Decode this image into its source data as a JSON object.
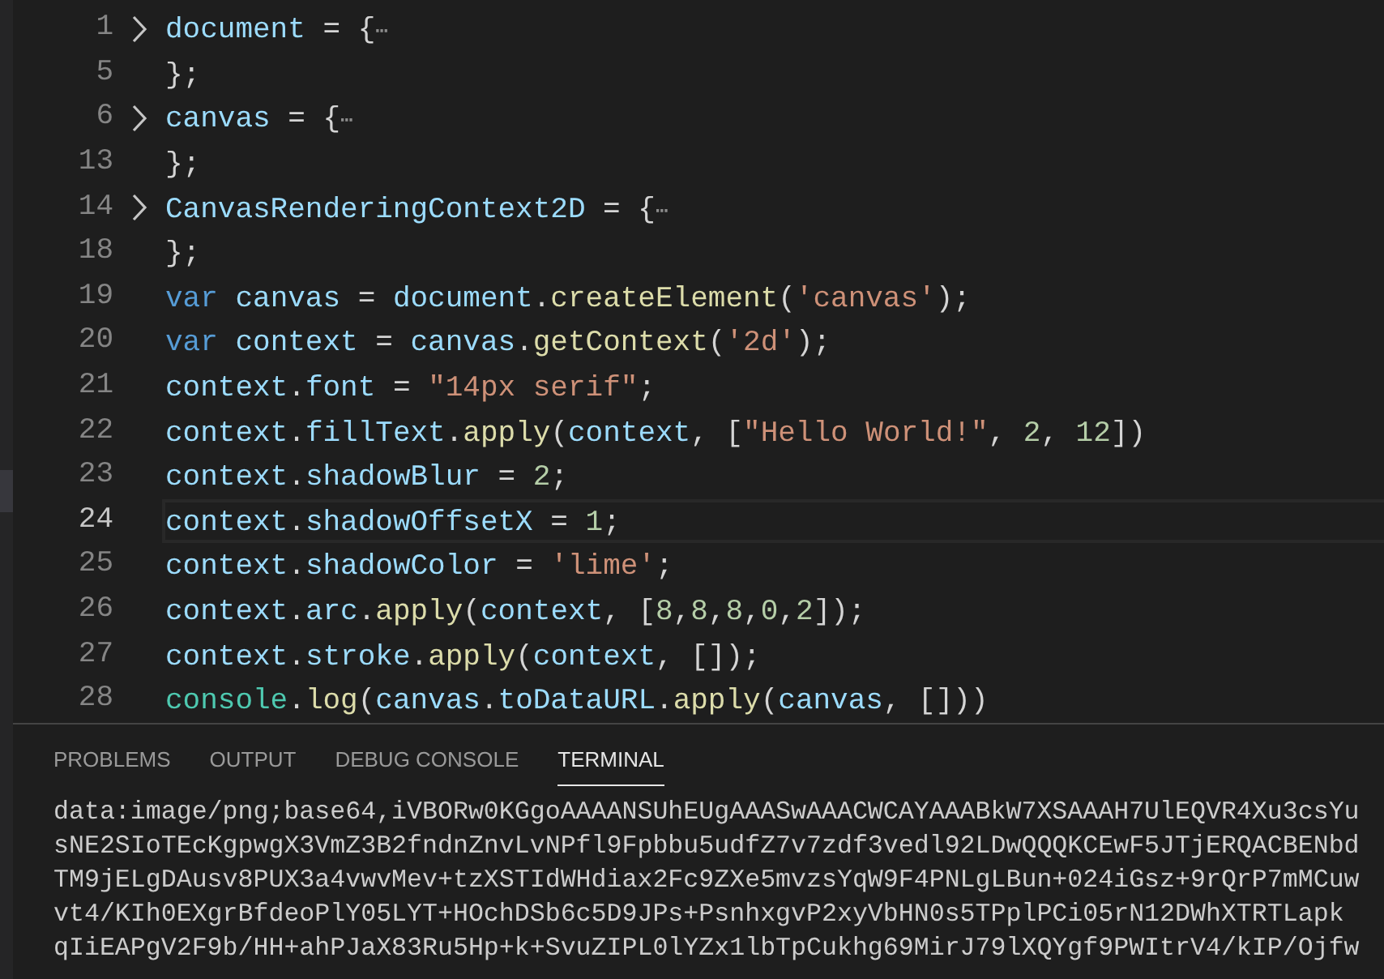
{
  "editor": {
    "lines": [
      {
        "number": "1",
        "foldable": true,
        "current": false,
        "tokens": [
          {
            "kind": "variable",
            "text": "document"
          },
          {
            "kind": "punct",
            "text": " = {"
          },
          {
            "kind": "ellipsis",
            "text": "⋯"
          }
        ]
      },
      {
        "number": "5",
        "foldable": false,
        "current": false,
        "tokens": [
          {
            "kind": "punct",
            "text": "};"
          }
        ]
      },
      {
        "number": "6",
        "foldable": true,
        "current": false,
        "tokens": [
          {
            "kind": "variable",
            "text": "canvas"
          },
          {
            "kind": "punct",
            "text": " = {"
          },
          {
            "kind": "ellipsis",
            "text": "⋯"
          }
        ]
      },
      {
        "number": "13",
        "foldable": false,
        "current": false,
        "tokens": [
          {
            "kind": "punct",
            "text": "};"
          }
        ]
      },
      {
        "number": "14",
        "foldable": true,
        "current": false,
        "tokens": [
          {
            "kind": "variable",
            "text": "CanvasRenderingContext2D"
          },
          {
            "kind": "punct",
            "text": " = {"
          },
          {
            "kind": "ellipsis",
            "text": "⋯"
          }
        ]
      },
      {
        "number": "18",
        "foldable": false,
        "current": false,
        "tokens": [
          {
            "kind": "punct",
            "text": "};"
          }
        ]
      },
      {
        "number": "19",
        "foldable": false,
        "current": false,
        "tokens": [
          {
            "kind": "keyword",
            "text": "var "
          },
          {
            "kind": "variable",
            "text": "canvas"
          },
          {
            "kind": "punct",
            "text": " = "
          },
          {
            "kind": "variable",
            "text": "document"
          },
          {
            "kind": "punct",
            "text": "."
          },
          {
            "kind": "function",
            "text": "createElement"
          },
          {
            "kind": "punct",
            "text": "("
          },
          {
            "kind": "string",
            "text": "'canvas'"
          },
          {
            "kind": "punct",
            "text": ");"
          }
        ]
      },
      {
        "number": "20",
        "foldable": false,
        "current": false,
        "tokens": [
          {
            "kind": "keyword",
            "text": "var "
          },
          {
            "kind": "variable",
            "text": "context"
          },
          {
            "kind": "punct",
            "text": " = "
          },
          {
            "kind": "variable",
            "text": "canvas"
          },
          {
            "kind": "punct",
            "text": "."
          },
          {
            "kind": "function",
            "text": "getContext"
          },
          {
            "kind": "punct",
            "text": "("
          },
          {
            "kind": "string",
            "text": "'2d'"
          },
          {
            "kind": "punct",
            "text": ");"
          }
        ]
      },
      {
        "number": "21",
        "foldable": false,
        "current": false,
        "tokens": [
          {
            "kind": "variable",
            "text": "context"
          },
          {
            "kind": "punct",
            "text": "."
          },
          {
            "kind": "variable",
            "text": "font"
          },
          {
            "kind": "punct",
            "text": " = "
          },
          {
            "kind": "string",
            "text": "\"14px serif\""
          },
          {
            "kind": "punct",
            "text": ";"
          }
        ]
      },
      {
        "number": "22",
        "foldable": false,
        "current": false,
        "tokens": [
          {
            "kind": "variable",
            "text": "context"
          },
          {
            "kind": "punct",
            "text": "."
          },
          {
            "kind": "variable",
            "text": "fillText"
          },
          {
            "kind": "punct",
            "text": "."
          },
          {
            "kind": "function",
            "text": "apply"
          },
          {
            "kind": "punct",
            "text": "("
          },
          {
            "kind": "variable",
            "text": "context"
          },
          {
            "kind": "punct",
            "text": ", ["
          },
          {
            "kind": "string",
            "text": "\"Hello World!\""
          },
          {
            "kind": "punct",
            "text": ", "
          },
          {
            "kind": "number",
            "text": "2"
          },
          {
            "kind": "punct",
            "text": ", "
          },
          {
            "kind": "number",
            "text": "12"
          },
          {
            "kind": "punct",
            "text": "])"
          }
        ]
      },
      {
        "number": "23",
        "foldable": false,
        "current": false,
        "tokens": [
          {
            "kind": "variable",
            "text": "context"
          },
          {
            "kind": "punct",
            "text": "."
          },
          {
            "kind": "variable",
            "text": "shadowBlur"
          },
          {
            "kind": "punct",
            "text": " = "
          },
          {
            "kind": "number",
            "text": "2"
          },
          {
            "kind": "punct",
            "text": ";"
          }
        ]
      },
      {
        "number": "24",
        "foldable": false,
        "current": true,
        "tokens": [
          {
            "kind": "variable",
            "text": "context"
          },
          {
            "kind": "punct",
            "text": "."
          },
          {
            "kind": "variable",
            "text": "shadowOffsetX"
          },
          {
            "kind": "punct",
            "text": " = "
          },
          {
            "kind": "number",
            "text": "1"
          },
          {
            "kind": "punct",
            "text": ";"
          }
        ]
      },
      {
        "number": "25",
        "foldable": false,
        "current": false,
        "tokens": [
          {
            "kind": "variable",
            "text": "context"
          },
          {
            "kind": "punct",
            "text": "."
          },
          {
            "kind": "variable",
            "text": "shadowColor"
          },
          {
            "kind": "punct",
            "text": " = "
          },
          {
            "kind": "string",
            "text": "'lime'"
          },
          {
            "kind": "punct",
            "text": ";"
          }
        ]
      },
      {
        "number": "26",
        "foldable": false,
        "current": false,
        "tokens": [
          {
            "kind": "variable",
            "text": "context"
          },
          {
            "kind": "punct",
            "text": "."
          },
          {
            "kind": "variable",
            "text": "arc"
          },
          {
            "kind": "punct",
            "text": "."
          },
          {
            "kind": "function",
            "text": "apply"
          },
          {
            "kind": "punct",
            "text": "("
          },
          {
            "kind": "variable",
            "text": "context"
          },
          {
            "kind": "punct",
            "text": ", ["
          },
          {
            "kind": "number",
            "text": "8"
          },
          {
            "kind": "punct",
            "text": ","
          },
          {
            "kind": "number",
            "text": "8"
          },
          {
            "kind": "punct",
            "text": ","
          },
          {
            "kind": "number",
            "text": "8"
          },
          {
            "kind": "punct",
            "text": ","
          },
          {
            "kind": "number",
            "text": "0"
          },
          {
            "kind": "punct",
            "text": ","
          },
          {
            "kind": "number",
            "text": "2"
          },
          {
            "kind": "punct",
            "text": "]);"
          }
        ]
      },
      {
        "number": "27",
        "foldable": false,
        "current": false,
        "tokens": [
          {
            "kind": "variable",
            "text": "context"
          },
          {
            "kind": "punct",
            "text": "."
          },
          {
            "kind": "variable",
            "text": "stroke"
          },
          {
            "kind": "punct",
            "text": "."
          },
          {
            "kind": "function",
            "text": "apply"
          },
          {
            "kind": "punct",
            "text": "("
          },
          {
            "kind": "variable",
            "text": "context"
          },
          {
            "kind": "punct",
            "text": ", []);"
          }
        ]
      },
      {
        "number": "28",
        "foldable": false,
        "current": false,
        "tokens": [
          {
            "kind": "type",
            "text": "console"
          },
          {
            "kind": "punct",
            "text": "."
          },
          {
            "kind": "function",
            "text": "log"
          },
          {
            "kind": "punct",
            "text": "("
          },
          {
            "kind": "variable",
            "text": "canvas"
          },
          {
            "kind": "punct",
            "text": "."
          },
          {
            "kind": "variable",
            "text": "toDataURL"
          },
          {
            "kind": "punct",
            "text": "."
          },
          {
            "kind": "function",
            "text": "apply"
          },
          {
            "kind": "punct",
            "text": "("
          },
          {
            "kind": "variable",
            "text": "canvas"
          },
          {
            "kind": "punct",
            "text": ", []))"
          }
        ]
      }
    ]
  },
  "panel": {
    "tabs": [
      {
        "label": "PROBLEMS",
        "selected": false
      },
      {
        "label": "OUTPUT",
        "selected": false
      },
      {
        "label": "DEBUG CONSOLE",
        "selected": false
      },
      {
        "label": "TERMINAL",
        "selected": true
      }
    ],
    "terminal_lines": [
      "data:image/png;base64,iVBORw0KGgoAAAANSUhEUgAAASwAAACWCAYAAABkW7XSAAAH7UlEQVR4Xu3csYu",
      "sNE2SIoTEcKgpwgX3VmZ3B2fndnZnvLvNPfl9Fpbbu5udfZ7v7zdf3vedl92LDwQQQKCEwF5JTjERQACBENbd",
      "TM9jELgDAusv8PUX3a4vwvMev+tzXSTIdWHdiax2Fc9ZXe5mvzsYqW9F4PNLgLBun+024iGsz+9rQrP7mMCuw",
      "vt4/KIh0EXgrBfdeoPlY05LYT+HOchDSb6c5D9JPs+PsnhxgvP2xyVbHN0s5TPplPCi05rN12DWhXTRTLapk",
      "qIiEAPgV2F9b/HH+ahPJaX83Ru5Hp+k+SvuZIPL0lYZx1lbTpCukhg69MirJ79lXQYgf9PWItrV4/kIP/Ojfw"
    ]
  }
}
